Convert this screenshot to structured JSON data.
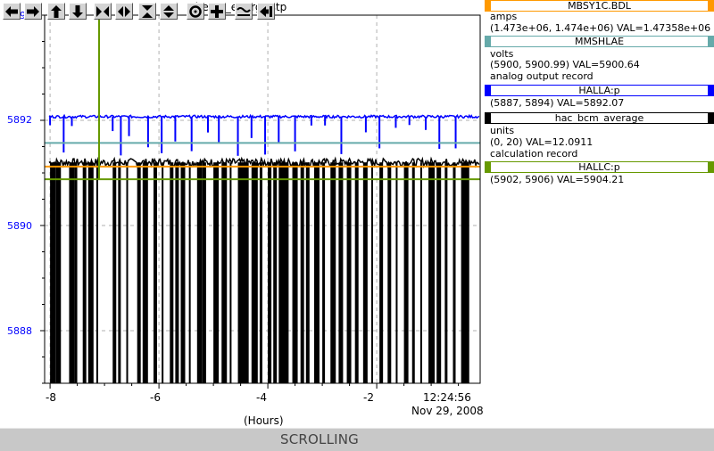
{
  "plot": {
    "title": "beam_energy.stp",
    "y_ticks": [
      "5894",
      "5892",
      "5890",
      "5888"
    ],
    "x_ticks": [
      "-8",
      "-6",
      "-4",
      "-2"
    ],
    "x_unit_label": "(Hours)",
    "timestamp_time": "12:24:56",
    "timestamp_date": "Nov 29, 2008"
  },
  "chart_data": {
    "type": "line",
    "title": "beam_energy.stp",
    "xlabel": "(Hours)",
    "ylabel": "",
    "xlim": [
      -8.1,
      -0.1
    ],
    "ylim": [
      5887,
      5894
    ],
    "x_tick_labels": [
      "-8",
      "-6",
      "-4",
      "-2"
    ],
    "y_tick_labels": [
      "5894",
      "5892",
      "5890",
      "5888"
    ],
    "grid": true,
    "series": [
      {
        "name": "HALLA:p",
        "color": "#0000ff",
        "baseline": 5892.07,
        "x": [
          -8.0,
          -7.1,
          -6.0,
          -4.0,
          -2.0,
          -0.2
        ],
        "values": [
          5892.1,
          5892.08,
          5892.07,
          5892.05,
          5892.07,
          5892.07
        ]
      },
      {
        "name": "hac_bcm_average",
        "color": "#000000",
        "baseline": 5891.2,
        "x": [
          -8.0,
          -7.0,
          -6.0,
          -4.0,
          -2.0,
          -0.2
        ],
        "values": [
          5891.1,
          5891.2,
          5891.15,
          5891.25,
          5891.2,
          5891.3
        ]
      },
      {
        "name": "MBSY1C.BDL",
        "color": "#ff9900",
        "x": [
          -8.1,
          -0.1
        ],
        "values": [
          5891.12,
          5891.12
        ]
      },
      {
        "name": "MMSHLAE",
        "color": "#66aaaa",
        "x": [
          -8.1,
          -0.1
        ],
        "values": [
          5891.57,
          5891.57
        ]
      },
      {
        "name": "HALLC:p",
        "color": "#669900",
        "x": [
          -8.1,
          -0.1
        ],
        "values": [
          5890.88,
          5890.88
        ],
        "spike_x": -7.1
      }
    ],
    "black_dropouts_x": [
      -8.0,
      -7.9,
      -7.85,
      -7.65,
      -7.55,
      -7.4,
      -7.3,
      -7.15,
      -6.85,
      -6.75,
      -6.6,
      -6.4,
      -6.3,
      -6.1,
      -5.95,
      -5.8,
      -5.7,
      -5.6,
      -5.45,
      -5.3,
      -5.2,
      -5.0,
      -4.85,
      -4.7,
      -4.55,
      -4.45,
      -4.3,
      -4.15,
      -4.0,
      -3.9,
      -3.8,
      -3.7,
      -3.55,
      -3.4,
      -3.3,
      -3.15,
      -3.0,
      -2.85,
      -2.7,
      -2.55,
      -2.4,
      -2.25,
      -2.1,
      -1.95,
      -1.8,
      -1.65,
      -1.5,
      -1.35,
      -1.2,
      -1.05,
      -0.9,
      -0.75,
      -0.6,
      -0.45,
      -0.35
    ],
    "blue_spikes_x": [
      -8.0,
      -7.75,
      -7.6,
      -7.1,
      -6.85,
      -6.7,
      -6.55,
      -6.2,
      -5.95,
      -5.7,
      -5.4,
      -5.1,
      -4.9,
      -4.55,
      -4.3,
      -4.05,
      -3.8,
      -3.5,
      -3.2,
      -2.95,
      -2.65,
      -2.2,
      -1.95,
      -1.65,
      -1.4,
      -1.1,
      -0.85,
      -0.55
    ]
  },
  "legend": [
    {
      "name": "MBSY1C.BDL",
      "color": "#ff9900",
      "units": "amps",
      "range_text": "(1.473e+06, 1.474e+06)  VAL=1.47358e+06",
      "record": ""
    },
    {
      "name": "MMSHLAE",
      "color": "#66aaaa",
      "units": "volts",
      "range_text": "(5900, 5900.99)  VAL=5900.64",
      "record": "analog output record"
    },
    {
      "name": "HALLA:p",
      "color": "#0000ff",
      "units": "",
      "range_text": "(5887, 5894) VAL=5892.07",
      "record": ""
    },
    {
      "name": "hac_bcm_average",
      "color": "#000000",
      "units": "units",
      "range_text": "(0, 20) VAL=12.0911",
      "record": "calculation record"
    },
    {
      "name": "HALLC:p",
      "color": "#669900",
      "units": "",
      "range_text": "(5902, 5906) VAL=5904.21",
      "record": ""
    }
  ],
  "toolbar": {
    "icons": [
      "arrow-left-icon",
      "arrow-right-icon",
      "arrow-up-icon",
      "arrow-down-icon",
      "zoom-in-horizontal-icon",
      "zoom-out-horizontal-icon",
      "zoom-in-vertical-icon",
      "zoom-out-vertical-icon",
      "autoscale-icon",
      "add-icon",
      "style-icon",
      "undo-icon"
    ],
    "status": "SCROLLING"
  }
}
